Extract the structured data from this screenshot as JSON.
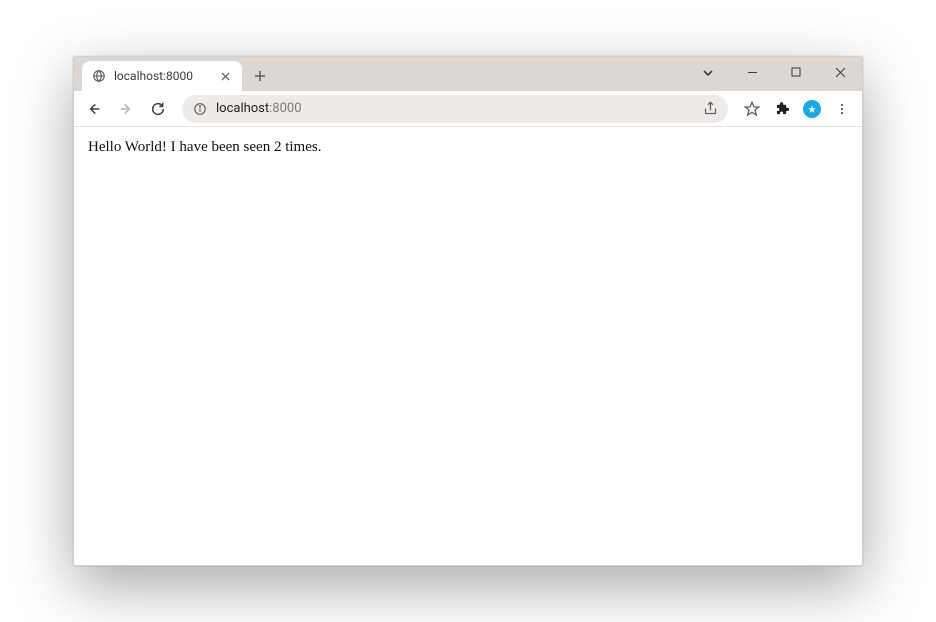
{
  "tab": {
    "title": "localhost:8000"
  },
  "address": {
    "host": "localhost",
    "rest": ":8000"
  },
  "page": {
    "body_text": "Hello World! I have been seen 2 times."
  }
}
